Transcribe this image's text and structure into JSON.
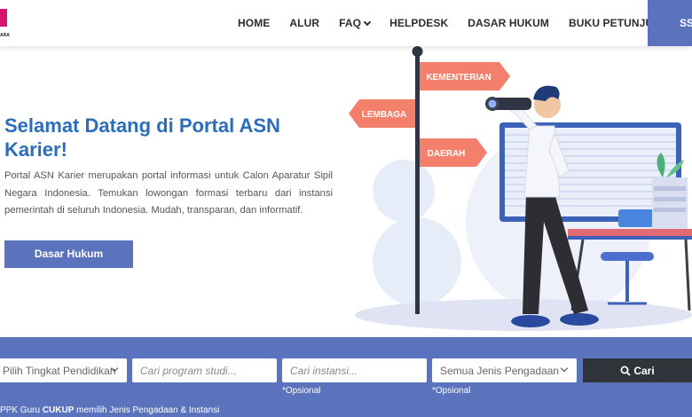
{
  "header": {
    "logo_text": "ARA",
    "nav": [
      {
        "label": "HOME"
      },
      {
        "label": "ALUR"
      },
      {
        "label": "FAQ"
      },
      {
        "label": "HELPDESK"
      },
      {
        "label": "DASAR HUKUM"
      },
      {
        "label": "BUKU PETUNJUK"
      }
    ],
    "sso_label": "SSO"
  },
  "hero": {
    "title": "Selamat Datang di Portal ASN Karier!",
    "description": "Portal ASN Karier merupakan portal informasi untuk Calon Aparatur Sipil Negara Indonesia. Temukan lowongan formasi terbaru dari instansi pemerintah di seluruh Indonesia. Mudah, transparan, dan informatif.",
    "button_label": "Dasar Hukum"
  },
  "illustration": {
    "signs": [
      "KEMENTERIAN",
      "LEMBAGA",
      "DAERAH"
    ]
  },
  "search": {
    "education_select": "Pilih Tingkat Pendidikan",
    "program_placeholder": "Cari program studi...",
    "instansi_placeholder": "Cari instansi...",
    "procurement_select": "Semua Jenis Pengadaan",
    "search_button": "Cari",
    "optional_note": "*Opsional",
    "footnote_prefix": "PPK Guru ",
    "footnote_bold": "CUKUP",
    "footnote_suffix": " memilih Jenis Pengadaan & Instansi"
  },
  "colors": {
    "accent": "#5b73bd",
    "title_blue": "#2a6ebb",
    "sign_orange": "#f47f6b",
    "dark_button": "#2f343a"
  }
}
